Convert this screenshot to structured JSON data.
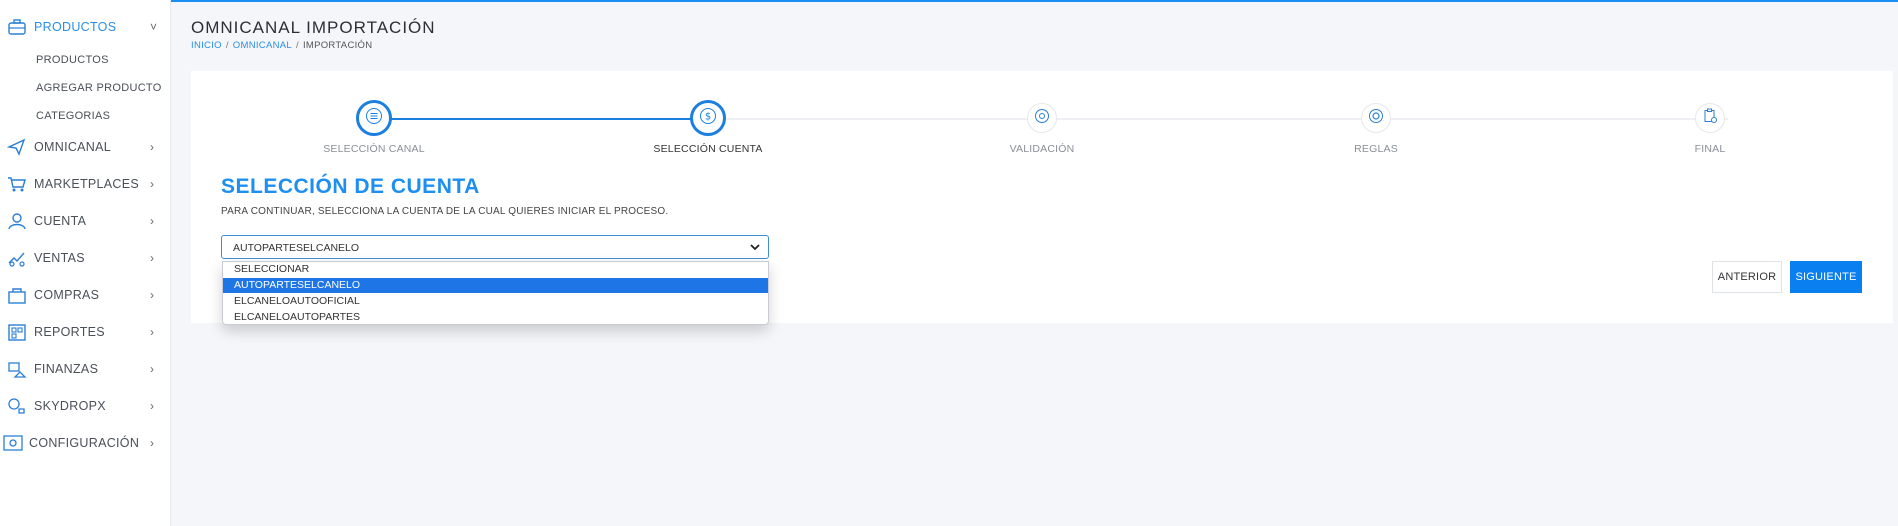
{
  "colors": {
    "accent": "#1b8ef5",
    "primary_button": "#0a7ff0",
    "selected_option": "#1e75e6",
    "step_done": "#1b7fe0",
    "step_pending": "#e6e8ec"
  },
  "sidebar": {
    "items": [
      {
        "label": "PRODUCTOS",
        "icon": "briefcase-icon",
        "active": true,
        "expanded": true
      },
      {
        "label": "OMNICANAL",
        "icon": "share-icon"
      },
      {
        "label": "MARKETPLACES",
        "icon": "cart-icon"
      },
      {
        "label": "CUENTA",
        "icon": "user-icon"
      },
      {
        "label": "VENTAS",
        "icon": "sales-icon"
      },
      {
        "label": "COMPRAS",
        "icon": "shopping-bag-icon"
      },
      {
        "label": "REPORTES",
        "icon": "report-icon"
      },
      {
        "label": "FINANZAS",
        "icon": "finance-icon"
      },
      {
        "label": "SKYDROPX",
        "icon": "delivery-icon"
      },
      {
        "label": "CONFIGURACIÓN",
        "icon": "settings-icon"
      }
    ],
    "subitems": [
      {
        "label": "PRODUCTOS"
      },
      {
        "label": "AGREGAR PRODUCTO"
      },
      {
        "label": "CATEGORIAS"
      }
    ]
  },
  "header": {
    "title": "OMNICANAL IMPORTACIÓN",
    "breadcrumb": [
      "INICIO",
      "OMNICANAL",
      "IMPORTACIÓN"
    ],
    "separator": "/"
  },
  "stepper": {
    "steps": [
      {
        "label": "SELECCIÓN CANAL",
        "status": "done",
        "icon": "list-icon"
      },
      {
        "label": "SELECCIÓN CUENTA",
        "status": "current",
        "icon": "dollar-icon"
      },
      {
        "label": "VALIDACIÓN",
        "status": "pending",
        "icon": "gear-check-icon"
      },
      {
        "label": "REGLAS",
        "status": "pending",
        "icon": "gear-icon"
      },
      {
        "label": "FINAL",
        "status": "pending",
        "icon": "clipboard-icon"
      }
    ]
  },
  "section": {
    "title": "SELECCIÓN DE CUENTA",
    "description": "PARA CONTINUAR, SELECCIONA LA CUENTA DE LA CUAL QUIERES INICIAR EL PROCESO."
  },
  "account_select": {
    "value": "AUTOPARTESELCANELO",
    "options": [
      "SELECCIONAR",
      "AUTOPARTESELCANELO",
      "ELCANELOAUTOOFICIAL",
      "ELCANELOAUTOPARTES"
    ],
    "selected_index": 1
  },
  "buttons": {
    "previous": "ANTERIOR",
    "next": "SIGUIENTE"
  }
}
